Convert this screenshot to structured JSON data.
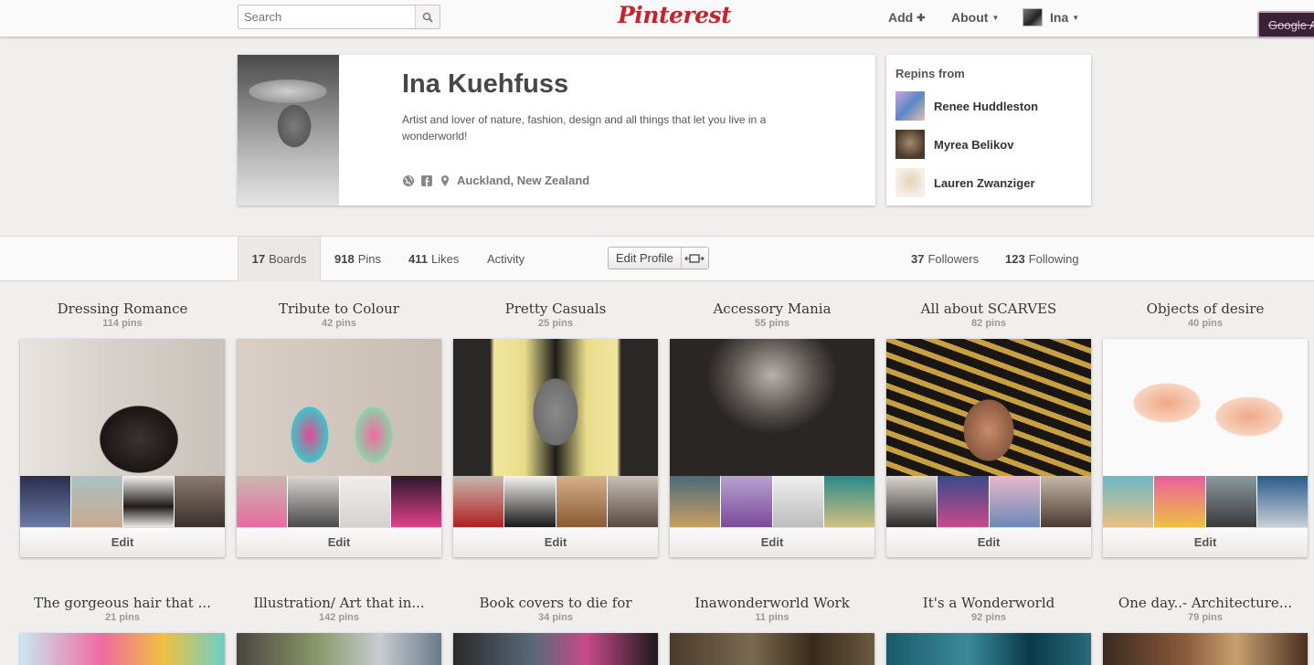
{
  "header": {
    "search_placeholder": "Search",
    "logo": "Pinterest",
    "add_label": "Add",
    "about_label": "About",
    "user_label": "Ina",
    "google_button": "Google A"
  },
  "profile": {
    "name": "Ina Kuehfuss",
    "bio": "Artist and lover of nature, fashion, design and all things that let you live in a wonderworld!",
    "location": "Auckland, New Zealand"
  },
  "repins": {
    "title": "Repins from",
    "users": [
      "Renee Huddleston",
      "Myrea Belikov",
      "Lauren Zwanziger"
    ]
  },
  "tabs": {
    "boards_count": "17",
    "boards_label": "Boards",
    "pins_count": "918",
    "pins_label": "Pins",
    "likes_count": "411",
    "likes_label": "Likes",
    "activity_label": "Activity",
    "edit_profile": "Edit Profile",
    "followers_count": "37",
    "followers_label": "Followers",
    "following_count": "123",
    "following_label": "Following"
  },
  "boards": [
    {
      "title": "Dressing Romance",
      "count": "114 pins",
      "edit": "Edit"
    },
    {
      "title": "Tribute to Colour",
      "count": "42 pins",
      "edit": "Edit"
    },
    {
      "title": "Pretty Casuals",
      "count": "25 pins",
      "edit": "Edit"
    },
    {
      "title": "Accessory Mania",
      "count": "55 pins",
      "edit": "Edit"
    },
    {
      "title": "All about SCARVES",
      "count": "82 pins",
      "edit": "Edit"
    },
    {
      "title": "Objects of desire",
      "count": "40 pins",
      "edit": "Edit"
    }
  ],
  "boards_row2": [
    {
      "title": "The gorgeous hair that ...",
      "count": "21 pins"
    },
    {
      "title": "Illustration/ Art that in...",
      "count": "142 pins"
    },
    {
      "title": "Book covers to die for",
      "count": "34 pins"
    },
    {
      "title": "Inawonderworld Work",
      "count": "11 pins"
    },
    {
      "title": "It's a Wonderworld",
      "count": "92 pins"
    },
    {
      "title": "One day..- Architecture...",
      "count": "79 pins"
    }
  ],
  "colors": {
    "brand": "#c8232c",
    "background": "#f1efee"
  }
}
